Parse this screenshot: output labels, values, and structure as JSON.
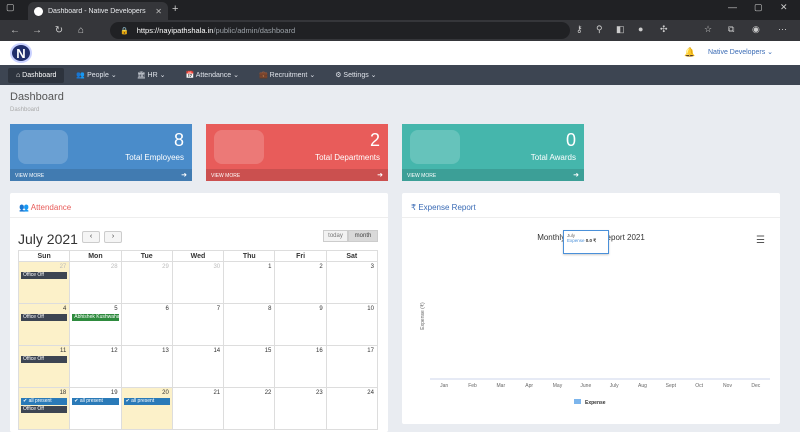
{
  "browser": {
    "tab_title": "Dashboard - Native Developers",
    "url_host": "https://nayipathshala.in",
    "url_path": "/public/admin/dashboard"
  },
  "app": {
    "logo_letter": "N",
    "user_name": "Native Developers ⌄",
    "menu": [
      {
        "label": "⌂ Dashboard",
        "active": true
      },
      {
        "label": "👥 People ⌄"
      },
      {
        "label": "🏛 HR ⌄"
      },
      {
        "label": "📅 Attendance ⌄"
      },
      {
        "label": "💼 Recruitment ⌄"
      },
      {
        "label": "⚙ Settings ⌄"
      }
    ]
  },
  "page": {
    "title": "Dashboard",
    "breadcrumb": "Dashboard"
  },
  "stats": [
    {
      "value": "8",
      "label": "Total Employees",
      "footer": "VIEW MORE",
      "color": "#4a8cca"
    },
    {
      "value": "2",
      "label": "Total Departments",
      "footer": "VIEW MORE",
      "color": "#e85c5a"
    },
    {
      "value": "0",
      "label": "Total Awards",
      "footer": "VIEW MORE",
      "color": "#45b6ac"
    }
  ],
  "attendance": {
    "title": "👥 Attendance",
    "month": "July 2021",
    "today_label": "today",
    "month_label": "month",
    "days": [
      "Sun",
      "Mon",
      "Tue",
      "Wed",
      "Thu",
      "Fri",
      "Sat"
    ],
    "weeks": [
      [
        {
          "d": "27",
          "o": true,
          "e": [
            "Office Off"
          ],
          "c": "dark"
        },
        {
          "d": "28",
          "o": true
        },
        {
          "d": "29",
          "o": true
        },
        {
          "d": "30",
          "o": true
        },
        {
          "d": "1"
        },
        {
          "d": "2"
        },
        {
          "d": "3"
        }
      ],
      [
        {
          "d": "4",
          "e": [
            "Office Off"
          ],
          "c": "dark"
        },
        {
          "d": "5",
          "e": [
            "Abhishek Kushwaha"
          ],
          "c": "green"
        },
        {
          "d": "6"
        },
        {
          "d": "7"
        },
        {
          "d": "8"
        },
        {
          "d": "9"
        },
        {
          "d": "10"
        }
      ],
      [
        {
          "d": "11",
          "e": [
            "Office Off"
          ],
          "c": "dark"
        },
        {
          "d": "12"
        },
        {
          "d": "13"
        },
        {
          "d": "14"
        },
        {
          "d": "15"
        },
        {
          "d": "16"
        },
        {
          "d": "17"
        }
      ],
      [
        {
          "d": "18",
          "e": [
            "✔ all present",
            "Office Off"
          ],
          "c": "mix"
        },
        {
          "d": "19",
          "e": [
            "✔ all present"
          ],
          "c": "blue"
        },
        {
          "d": "20",
          "e": [
            "✔ all present"
          ],
          "c": "blue",
          "today": true
        },
        {
          "d": "21"
        },
        {
          "d": "22"
        },
        {
          "d": "23"
        },
        {
          "d": "24"
        }
      ]
    ]
  },
  "expense": {
    "title": "₹ Expense Report",
    "tooltip_month": "July",
    "tooltip_series": "Expense",
    "tooltip_value": "0.0 ₹"
  },
  "chart_data": {
    "type": "line",
    "title": "Monthly Expense Report 2021",
    "ylabel": "Expense (₹)",
    "categories": [
      "Jan",
      "Feb",
      "Mar",
      "Apr",
      "May",
      "June",
      "July",
      "Aug",
      "Sept",
      "Oct",
      "Nov",
      "Dec"
    ],
    "series": [
      {
        "name": "Expense",
        "values": [
          0,
          0,
          0,
          0,
          0,
          0,
          0,
          0,
          0,
          0,
          0,
          0
        ],
        "color": "#7cb5ec"
      }
    ],
    "legend": "bottom-center"
  }
}
